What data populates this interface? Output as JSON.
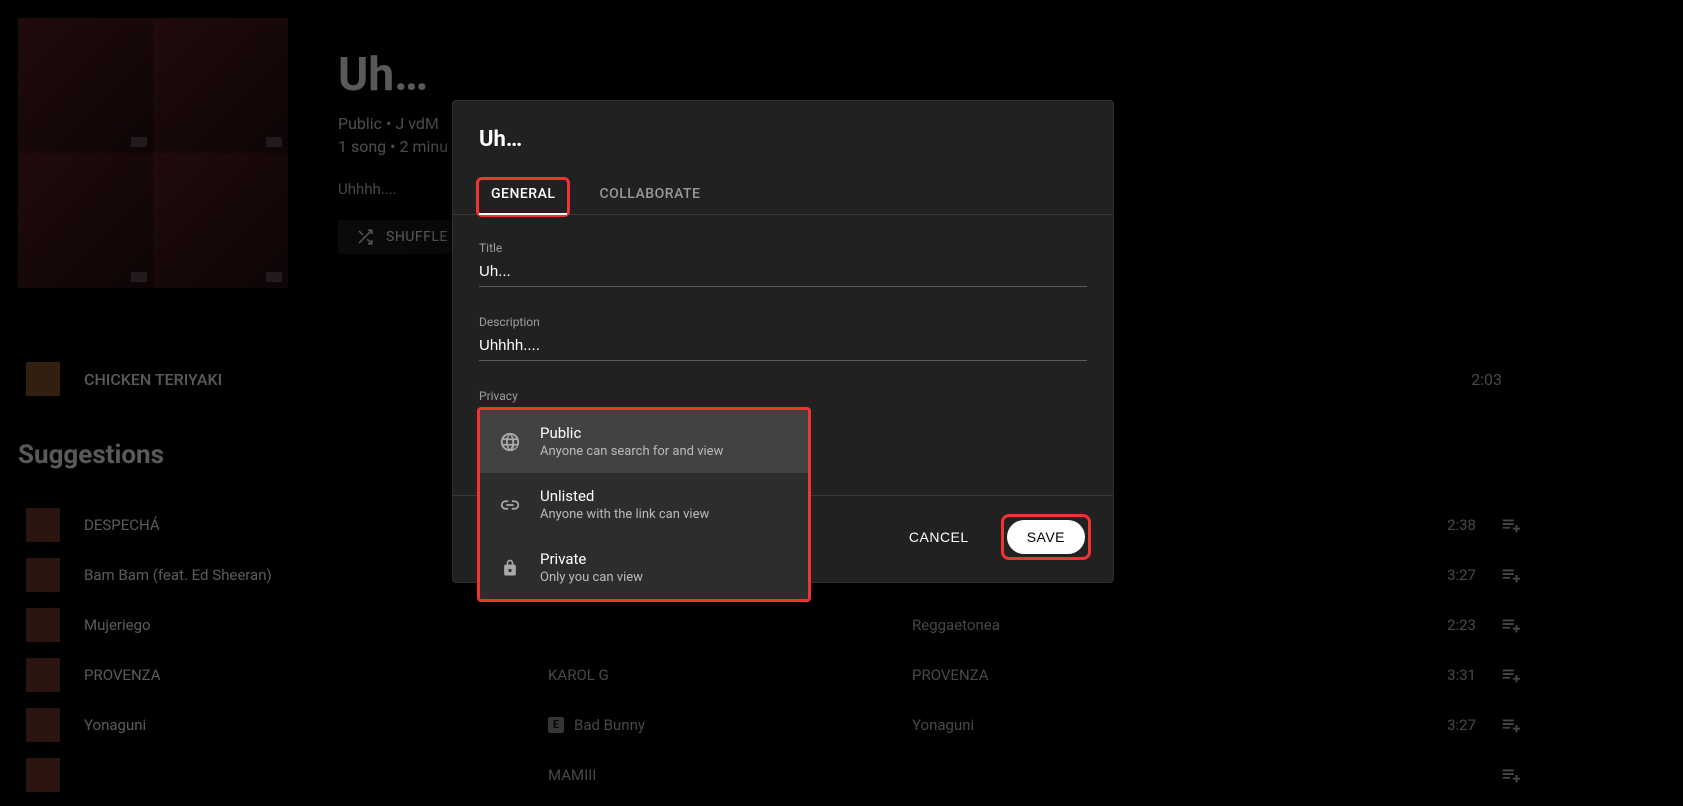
{
  "header": {
    "title": "Uh…",
    "meta1": "Public • J vdM",
    "meta2": "1 song • 2 minu",
    "description": "Uhhhh....",
    "shuffle_label": "SHUFFLE"
  },
  "first_song": {
    "title": "CHICKEN TERIYAKI",
    "duration": "2:03"
  },
  "suggestions_heading": "Suggestions",
  "suggestions": [
    {
      "name": "DESPECHÁ",
      "artist": "",
      "album": "",
      "duration": "2:38",
      "explicit": false
    },
    {
      "name": "Bam Bam (feat. Ed Sheeran)",
      "artist": "",
      "album": "",
      "duration": "3:27",
      "explicit": false
    },
    {
      "name": "Mujeriego",
      "artist": "",
      "album": "Reggaetonea",
      "duration": "2:23",
      "explicit": false
    },
    {
      "name": "PROVENZA",
      "artist": "KAROL G",
      "album": "PROVENZA",
      "duration": "3:31",
      "explicit": false
    },
    {
      "name": "Yonaguni",
      "artist": "Bad Bunny",
      "album": "Yonaguni",
      "duration": "3:27",
      "explicit": true
    },
    {
      "name": "",
      "artist": "MAMIII",
      "album": "",
      "duration": "",
      "explicit": false
    }
  ],
  "modal": {
    "title": "Uh…",
    "tabs": {
      "general": "GENERAL",
      "collaborate": "COLLABORATE"
    },
    "fields": {
      "title_label": "Title",
      "title_value": "Uh...",
      "description_label": "Description",
      "description_value": "Uhhhh....",
      "privacy_label": "Privacy"
    },
    "privacy_options": [
      {
        "key": "public",
        "title": "Public",
        "desc": "Anyone can search for and view"
      },
      {
        "key": "unlisted",
        "title": "Unlisted",
        "desc": "Anyone with the link can view"
      },
      {
        "key": "private",
        "title": "Private",
        "desc": "Only you can view"
      }
    ],
    "footer": {
      "cancel": "CANCEL",
      "save": "SAVE"
    }
  },
  "highlights": {
    "general_tab": true,
    "privacy_dropdown": true,
    "save_button": true
  }
}
